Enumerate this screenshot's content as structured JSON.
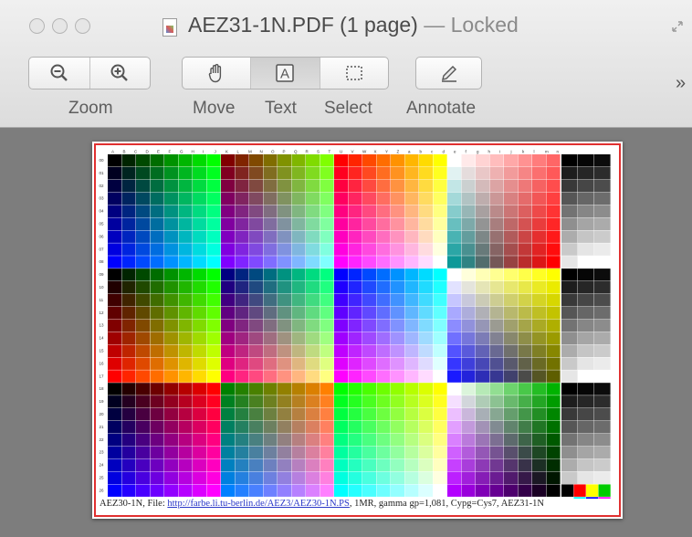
{
  "window": {
    "title": "AEZ31-1N.PDF (1 page)",
    "title_sep": " — ",
    "status": "Locked",
    "document_icon": "pdf-document-icon"
  },
  "toolbar": {
    "zoom_label": "Zoom",
    "move_label": "Move",
    "text_label": "Text",
    "select_label": "Select",
    "annotate_label": "Annotate",
    "overflow": "»",
    "icons": {
      "zoom_out": "zoom-out-icon",
      "zoom_in": "zoom-in-icon",
      "move": "hand-icon",
      "text": "text-cursor-icon",
      "select": "select-rect-icon",
      "annotate": "pencil-icon"
    },
    "text_tool_active": true
  },
  "page": {
    "col_labels": "A B C D E F G H I J K L M N O P Q R S T U V W X Y Z a b c d e f g h i j k l m n",
    "row_labels": [
      "00",
      "01",
      "02",
      "03",
      "04",
      "05",
      "06",
      "07",
      "08",
      "09",
      "10",
      "11",
      "12",
      "13",
      "14",
      "15",
      "16",
      "17",
      "18",
      "19",
      "20",
      "21",
      "22",
      "23",
      "24",
      "25",
      "26",
      "27"
    ],
    "footer_prefix": "AEZ30-1N, File: ",
    "footer_link": "http://farbe.li.tu-berlin.de/AEZ3/AEZ30-1N.PS",
    "footer_suffix": ", 1MR,      gamma gp=1,081, Cypg=Cys7, AEZ31-1N",
    "selection_color": "#e03030"
  }
}
